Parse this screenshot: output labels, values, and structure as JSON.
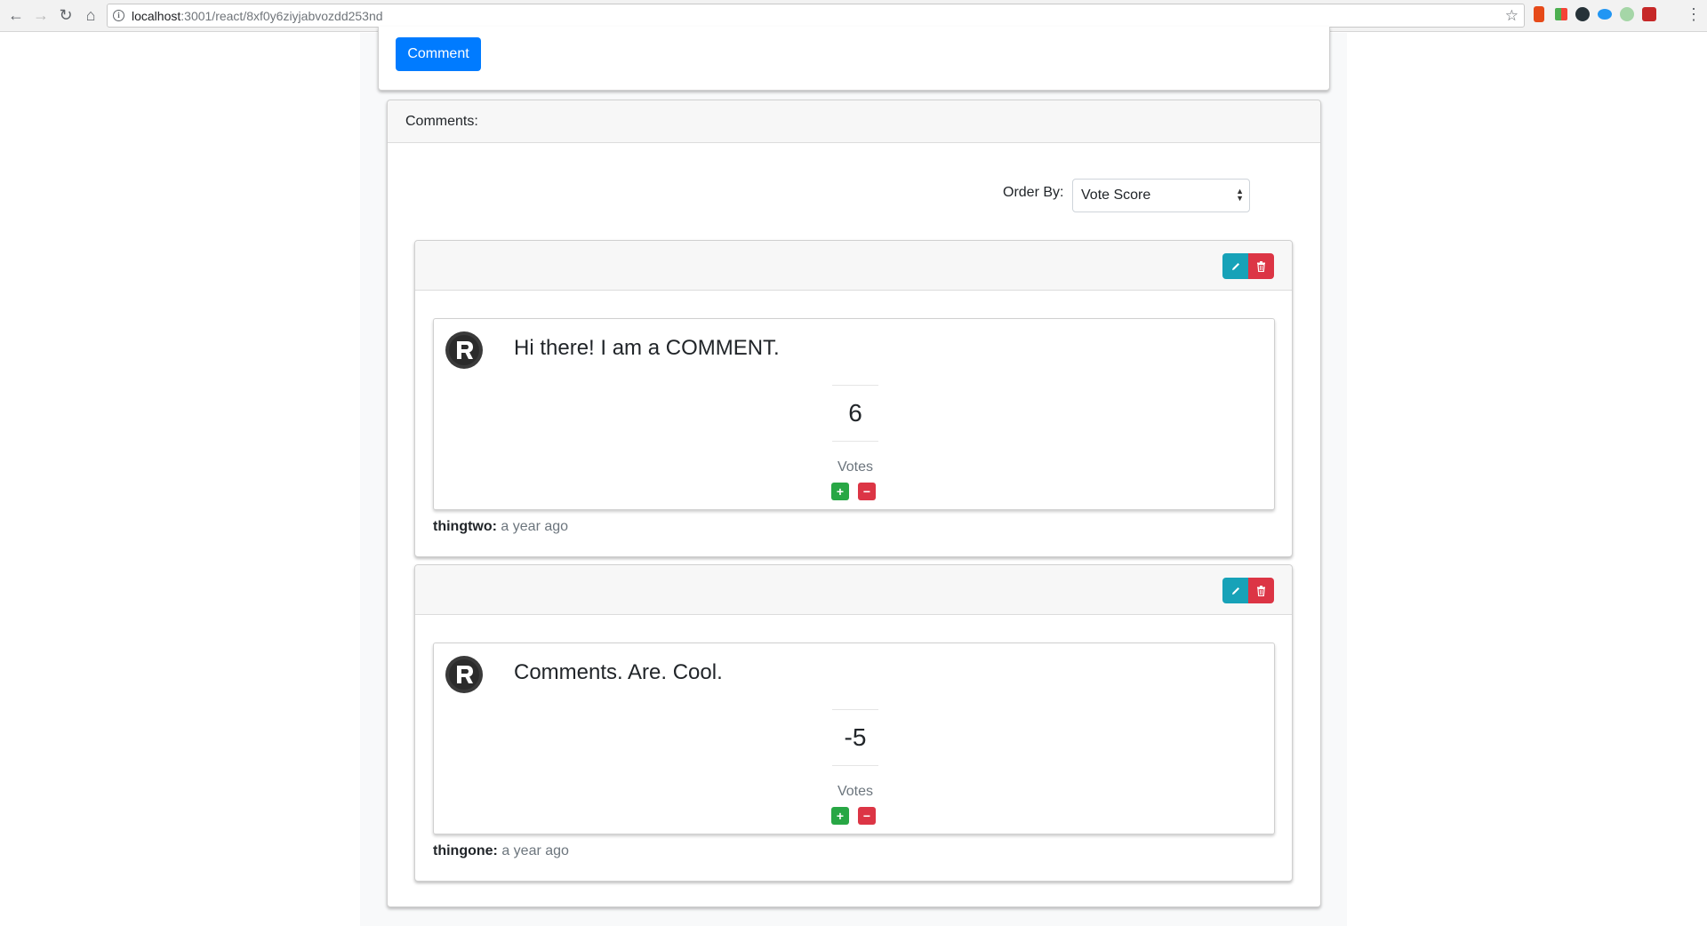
{
  "browser": {
    "url_host": "localhost",
    "url_rest": ":3001/react/8xf0y6ziyjabvozdd253nd"
  },
  "form": {
    "submit_label": "Comment"
  },
  "comments_section": {
    "header": "Comments:",
    "order_label": "Order By:",
    "order_selected": "Vote Score"
  },
  "comments": [
    {
      "body": "Hi there! I am a COMMENT.",
      "score": "6",
      "votes_label": "Votes",
      "author": "thingtwo:",
      "time": "a year ago"
    },
    {
      "body": "Comments. Are. Cool.",
      "score": "-5",
      "votes_label": "Votes",
      "author": "thingone:",
      "time": "a year ago"
    }
  ],
  "colors": {
    "primary": "#007bff",
    "info": "#17a2b8",
    "danger": "#dc3545",
    "success": "#28a745"
  }
}
